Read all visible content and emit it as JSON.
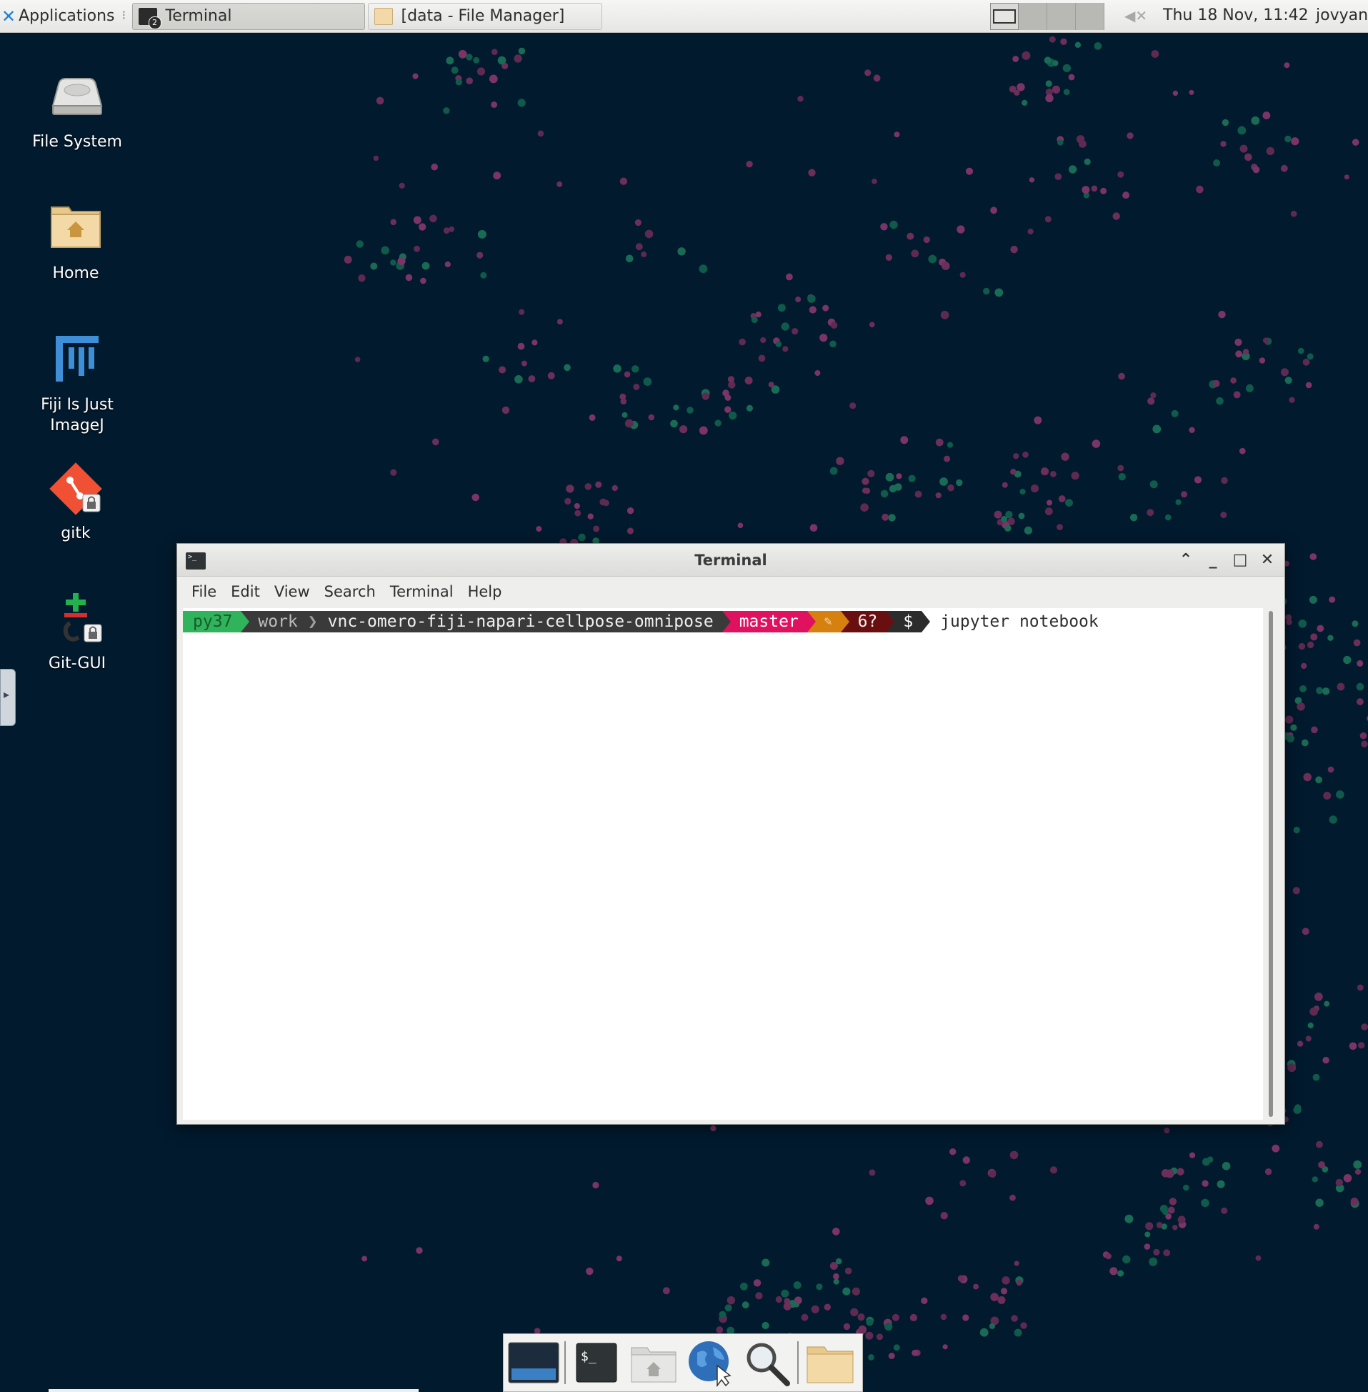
{
  "top_panel": {
    "applications_label": "Applications",
    "tasks": [
      {
        "label": "Terminal",
        "icon": "terminal-icon",
        "active": true
      },
      {
        "label": "[data - File Manager]",
        "icon": "folder-icon",
        "active": false
      }
    ],
    "clock": "Thu 18 Nov, 11:42",
    "user": "jovyan"
  },
  "desktop_icons": [
    {
      "label": "File System",
      "icon": "drive-icon"
    },
    {
      "label": "Home",
      "icon": "home-folder-icon"
    },
    {
      "label_line1": "Fiji Is Just",
      "label_line2": "ImageJ",
      "icon": "fiji-icon"
    },
    {
      "label": "gitk",
      "icon": "git-icon"
    },
    {
      "label": "Git-GUI",
      "icon": "git-gui-icon"
    }
  ],
  "terminal_window": {
    "title": "Terminal",
    "menu": [
      "File",
      "Edit",
      "View",
      "Search",
      "Terminal",
      "Help"
    ],
    "prompt": {
      "env": "py37",
      "path_parent": "work",
      "path_sep": "❯",
      "path_current": "vnc-omero-fiji-napari-cellpose-omnipose",
      "branch": "master",
      "dirty": "✎",
      "untracked": "6?",
      "symbol": "$",
      "command": "jupyter notebook"
    }
  },
  "dock": {
    "items": [
      "show-desktop-icon",
      "terminal-icon",
      "home-folder-icon",
      "web-browser-icon",
      "search-icon",
      "folder-icon"
    ]
  },
  "colors": {
    "wallpaper": "#021a2e",
    "env_bg": "#2fb35b",
    "path_bg": "#3a3a3a",
    "branch_bg": "#e0115f",
    "dirty_bg": "#d6800f",
    "untracked_bg": "#6a0f0f",
    "prompt_bg": "#2c2c2c"
  }
}
